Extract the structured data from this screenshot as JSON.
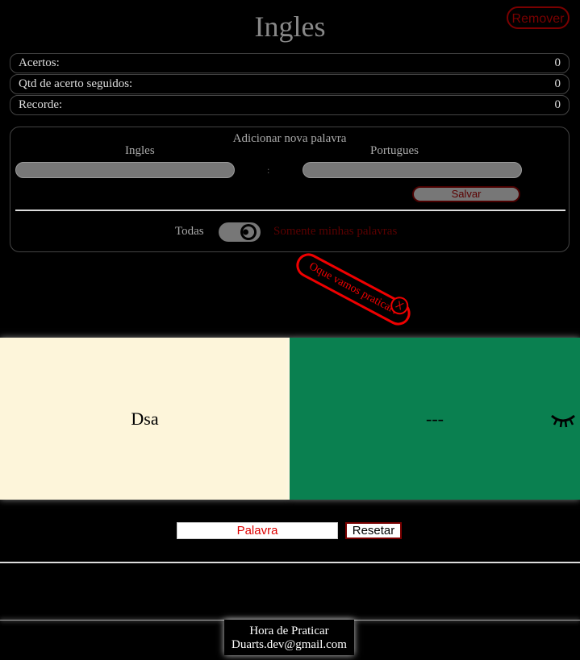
{
  "header": {
    "title": "Ingles",
    "remove_label": "Remover"
  },
  "stats": [
    {
      "label": "Acertos:",
      "value": "0"
    },
    {
      "label": "Qtd de acerto seguidos:",
      "value": "0"
    },
    {
      "label": "Recorde:",
      "value": "0"
    }
  ],
  "add_word": {
    "title": "Adicionar nova palavra",
    "col1_label": "Ingles",
    "col2_label": "Portugues",
    "separator": ":",
    "save_label": "Salvar"
  },
  "filter": {
    "all_label": "Todas",
    "mine_label": "Somente minhas palavras"
  },
  "tag": {
    "text": "Oque vamos praticar?",
    "close": "X"
  },
  "cards": {
    "front_text": "Dsa",
    "back_text": "---",
    "eye_icon": "eye-closed-icon"
  },
  "practice": {
    "input_placeholder": "Palavra",
    "reset_label": "Resetar"
  },
  "footer": {
    "line1": "Hora de Praticar",
    "line2": "Duarts.dev@gmail.com"
  },
  "colors": {
    "card_front": "#fdf5da",
    "card_back": "#0a8050",
    "accent": "#e00000"
  }
}
